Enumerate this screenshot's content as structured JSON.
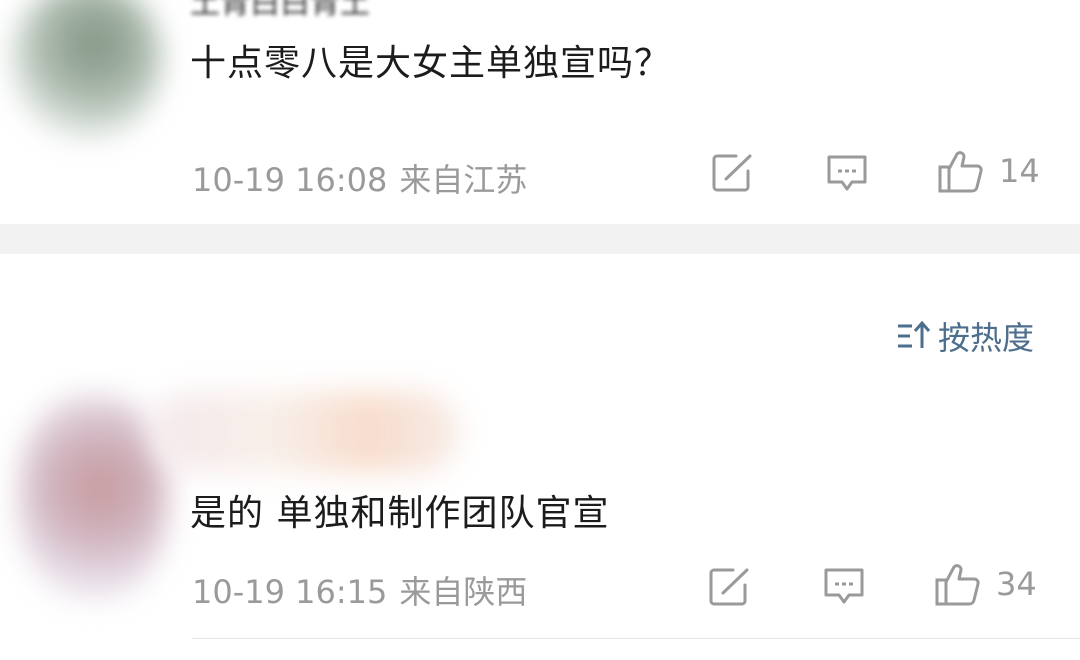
{
  "comments": [
    {
      "username": "土青白白青土",
      "text": "十点零八是大女主单独宣吗？",
      "date": "10-19 16:08",
      "location": "来自江苏",
      "like_count": "14"
    },
    {
      "text": "是的 单独和制作团队官宣",
      "date": "10-19 16:15",
      "location": "来自陕西",
      "like_count": "34"
    }
  ],
  "sort": {
    "label": "按热度",
    "icon": "sort-icon"
  },
  "icons": {
    "share": "share-icon",
    "reply": "comment-icon",
    "like": "thumbs-up-icon"
  },
  "colors": {
    "meta_text": "#9a9a9a",
    "sort_accent": "#4d6e8c",
    "divider": "#f2f2f2"
  }
}
